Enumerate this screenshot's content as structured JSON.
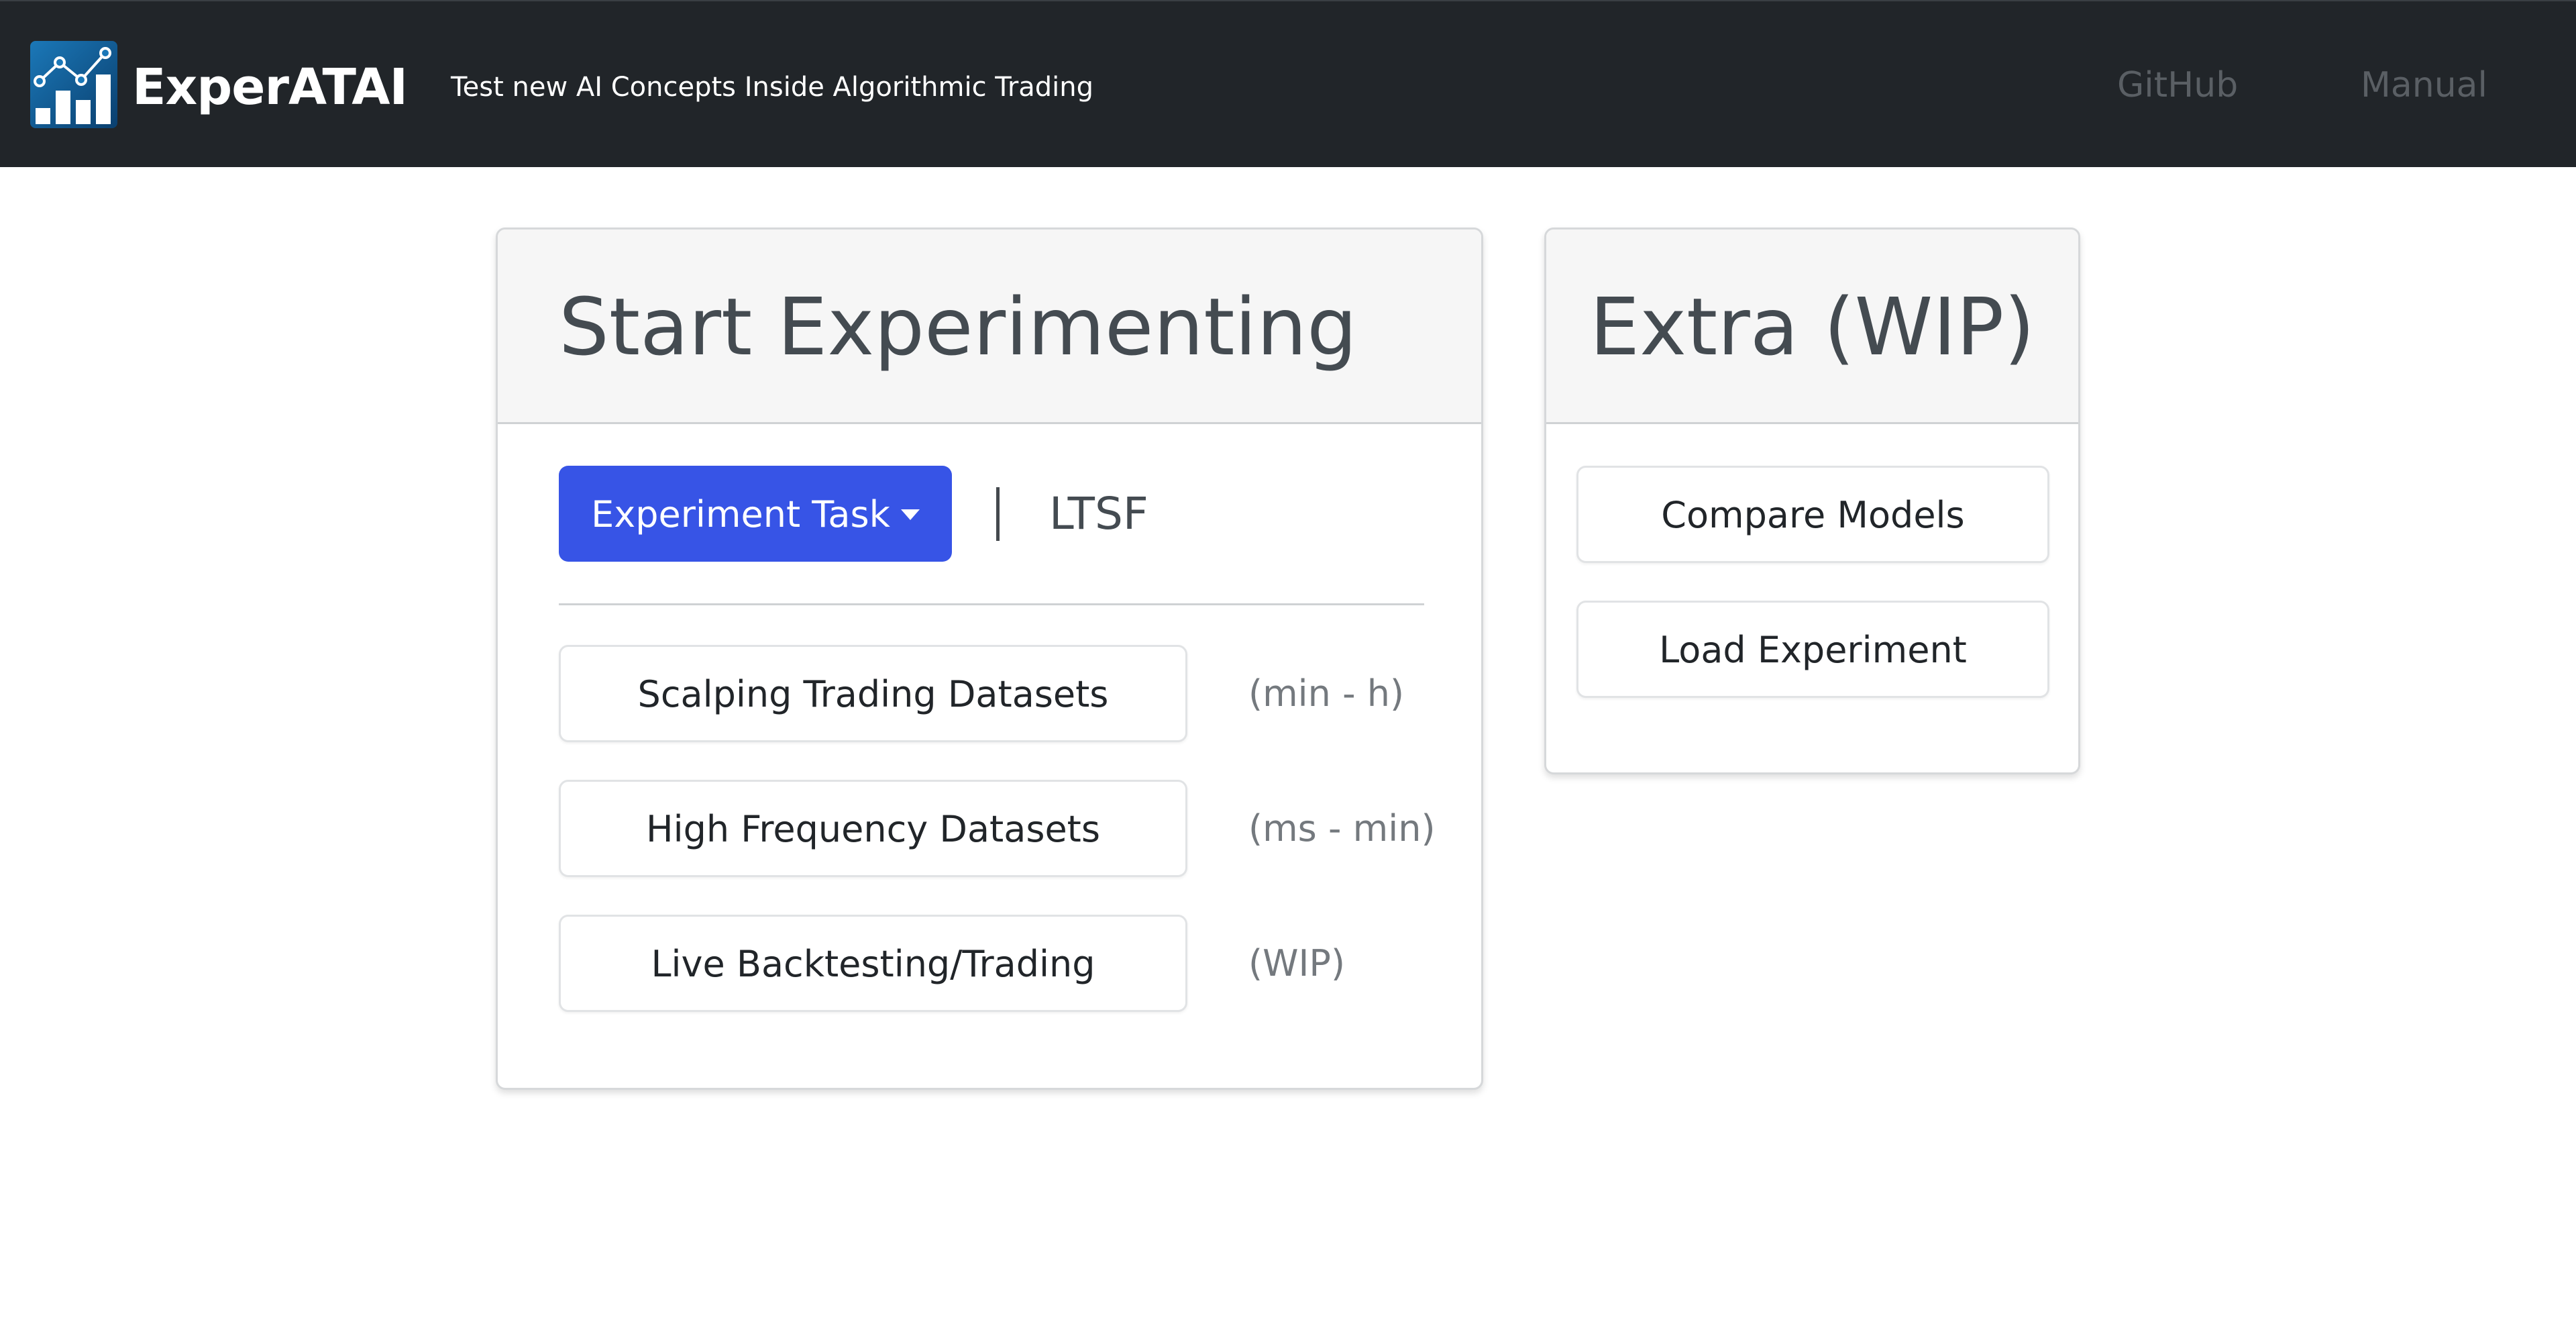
{
  "header": {
    "brand": "ExperATAI",
    "tagline": "Test new AI Concepts Inside Algorithmic Trading",
    "logo_icon": "line-chart-bars-logo-icon",
    "links": [
      {
        "label": "GitHub"
      },
      {
        "label": "Manual"
      }
    ]
  },
  "main_card": {
    "title": "Start Experimenting",
    "task_button_label": "Experiment Task",
    "task_value": "LTSF",
    "options": [
      {
        "label": "Scalping Trading Datasets",
        "note": "(min - h)"
      },
      {
        "label": "High Frequency Datasets",
        "note": "(ms - min)"
      },
      {
        "label": "Live Backtesting/Trading",
        "note": "(WIP)"
      }
    ]
  },
  "extra_card": {
    "title": "Extra (WIP)",
    "buttons": [
      {
        "label": "Compare Models"
      },
      {
        "label": "Load Experiment"
      }
    ]
  },
  "colors": {
    "navbar_bg": "#212529",
    "primary": "#3754e6",
    "card_header_bg": "#f6f6f6",
    "muted_text": "#74797e",
    "nav_link": "#5a5f64"
  }
}
